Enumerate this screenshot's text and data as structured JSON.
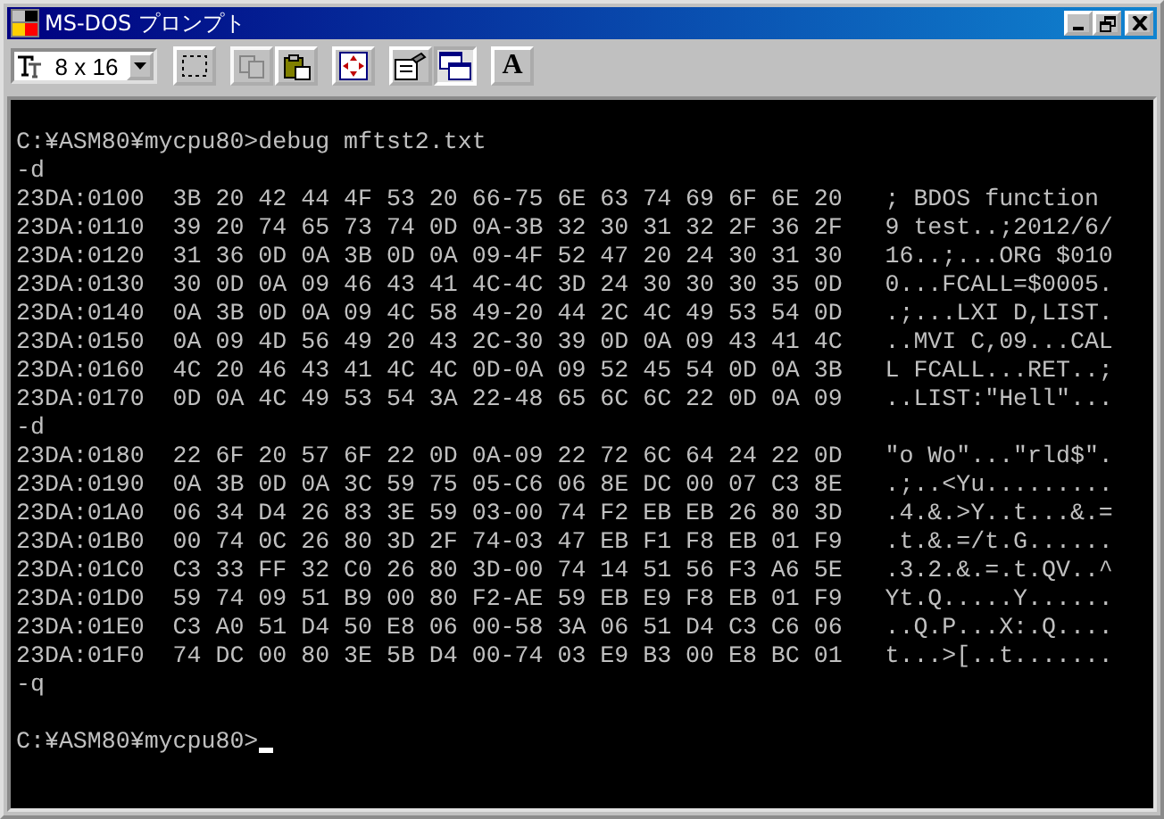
{
  "window": {
    "title": "MS-DOS プロンプト"
  },
  "toolbar": {
    "font_size": "8 x 16",
    "buttons": [
      {
        "kind": "mark",
        "disabled": false,
        "pressed": false
      },
      {
        "kind": "copy",
        "disabled": true,
        "pressed": false
      },
      {
        "kind": "paste",
        "disabled": false,
        "pressed": false
      },
      {
        "kind": "fullscreen",
        "disabled": false,
        "pressed": false
      },
      {
        "kind": "properties",
        "disabled": false,
        "pressed": false
      },
      {
        "kind": "background",
        "disabled": false,
        "pressed": true
      },
      {
        "kind": "font",
        "label": "A",
        "disabled": false,
        "pressed": false
      }
    ]
  },
  "console": {
    "lines": [
      {
        "text": "C:¥ASM80¥mycpu80>debug mftst2.txt",
        "blank_before": true
      },
      {
        "text": "-d",
        "blank_before": false
      },
      {
        "text": "23DA:0100  3B 20 42 44 4F 53 20 66-75 6E 63 74 69 6F 6E 20   ; BDOS function",
        "blank_before": false
      },
      {
        "text": "23DA:0110  39 20 74 65 73 74 0D 0A-3B 32 30 31 32 2F 36 2F   9 test..;2012/6/",
        "blank_before": false
      },
      {
        "text": "23DA:0120  31 36 0D 0A 3B 0D 0A 09-4F 52 47 20 24 30 31 30   16..;...ORG $010",
        "blank_before": false
      },
      {
        "text": "23DA:0130  30 0D 0A 09 46 43 41 4C-4C 3D 24 30 30 30 35 0D   0...FCALL=$0005.",
        "blank_before": false
      },
      {
        "text": "23DA:0140  0A 3B 0D 0A 09 4C 58 49-20 44 2C 4C 49 53 54 0D   .;...LXI D,LIST.",
        "blank_before": false
      },
      {
        "text": "23DA:0150  0A 09 4D 56 49 20 43 2C-30 39 0D 0A 09 43 41 4C   ..MVI C,09...CAL",
        "blank_before": false
      },
      {
        "text": "23DA:0160  4C 20 46 43 41 4C 4C 0D-0A 09 52 45 54 0D 0A 3B   L FCALL...RET..;",
        "blank_before": false
      },
      {
        "text": "23DA:0170  0D 0A 4C 49 53 54 3A 22-48 65 6C 6C 22 0D 0A 09   ..LIST:\"Hell\"...",
        "blank_before": false
      },
      {
        "text": "-d",
        "blank_before": false
      },
      {
        "text": "23DA:0180  22 6F 20 57 6F 22 0D 0A-09 22 72 6C 64 24 22 0D   \"o Wo\"...\"rld$\".",
        "blank_before": false
      },
      {
        "text": "23DA:0190  0A 3B 0D 0A 3C 59 75 05-C6 06 8E DC 00 07 C3 8E   .;..<Yu.........",
        "blank_before": false
      },
      {
        "text": "23DA:01A0  06 34 D4 26 83 3E 59 03-00 74 F2 EB EB 26 80 3D   .4.&.>Y..t...&.=",
        "blank_before": false
      },
      {
        "text": "23DA:01B0  00 74 0C 26 80 3D 2F 74-03 47 EB F1 F8 EB 01 F9   .t.&.=/t.G......",
        "blank_before": false
      },
      {
        "text": "23DA:01C0  C3 33 FF 32 C0 26 80 3D-00 74 14 51 56 F3 A6 5E   .3.2.&.=.t.QV..^",
        "blank_before": false
      },
      {
        "text": "23DA:01D0  59 74 09 51 B9 00 80 F2-AE 59 EB E9 F8 EB 01 F9   Yt.Q.....Y......",
        "blank_before": false
      },
      {
        "text": "23DA:01E0  C3 A0 51 D4 50 E8 06 00-58 3A 06 51 D4 C3 C6 06   ..Q.P...X:.Q....",
        "blank_before": false
      },
      {
        "text": "23DA:01F0  74 DC 00 80 3E 5B D4 00-74 03 E9 B3 00 E8 BC 01   t...>[..t.......",
        "blank_before": false
      },
      {
        "text": "-q",
        "blank_before": false
      },
      {
        "text": "C:¥ASM80¥mycpu80>",
        "blank_before": true,
        "cursor": true
      }
    ]
  }
}
